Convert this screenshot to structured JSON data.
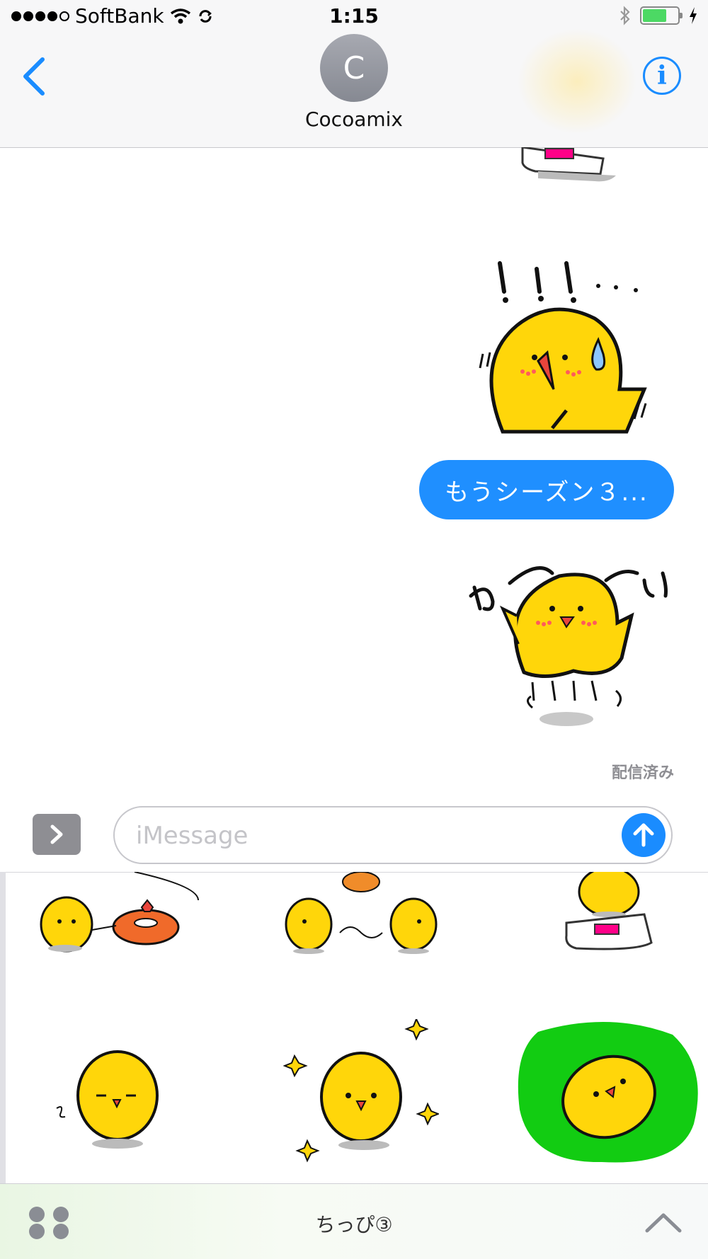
{
  "status_bar": {
    "carrier": "SoftBank",
    "time": "1:15",
    "battery_level": 0.75
  },
  "header": {
    "avatar_initial": "C",
    "contact_name": "Cocoamix"
  },
  "messages": [
    {
      "type": "sticker",
      "sticker": "weighing-scale-sticker"
    },
    {
      "type": "sticker",
      "sticker": "shocked-chick-sticker",
      "text": "!!!..."
    },
    {
      "type": "text",
      "text": "もうシーズン３..."
    },
    {
      "type": "sticker",
      "sticker": "jumping-chick-sticker",
      "text": "わーい"
    }
  ],
  "delivery_status": "配信済み",
  "compose": {
    "placeholder": "iMessage"
  },
  "sticker_tray": {
    "pack_name": "ちっぴ③",
    "stickers": [
      "donut-chick",
      "dancing-chicks",
      "scale-chick",
      "sigh-chick",
      "sparkle-chick",
      "grass-chick"
    ]
  },
  "colors": {
    "accent": "#1a8cff",
    "bubble": "#1f8fff",
    "chick": "#ffd60a",
    "grass": "#12cc12"
  }
}
